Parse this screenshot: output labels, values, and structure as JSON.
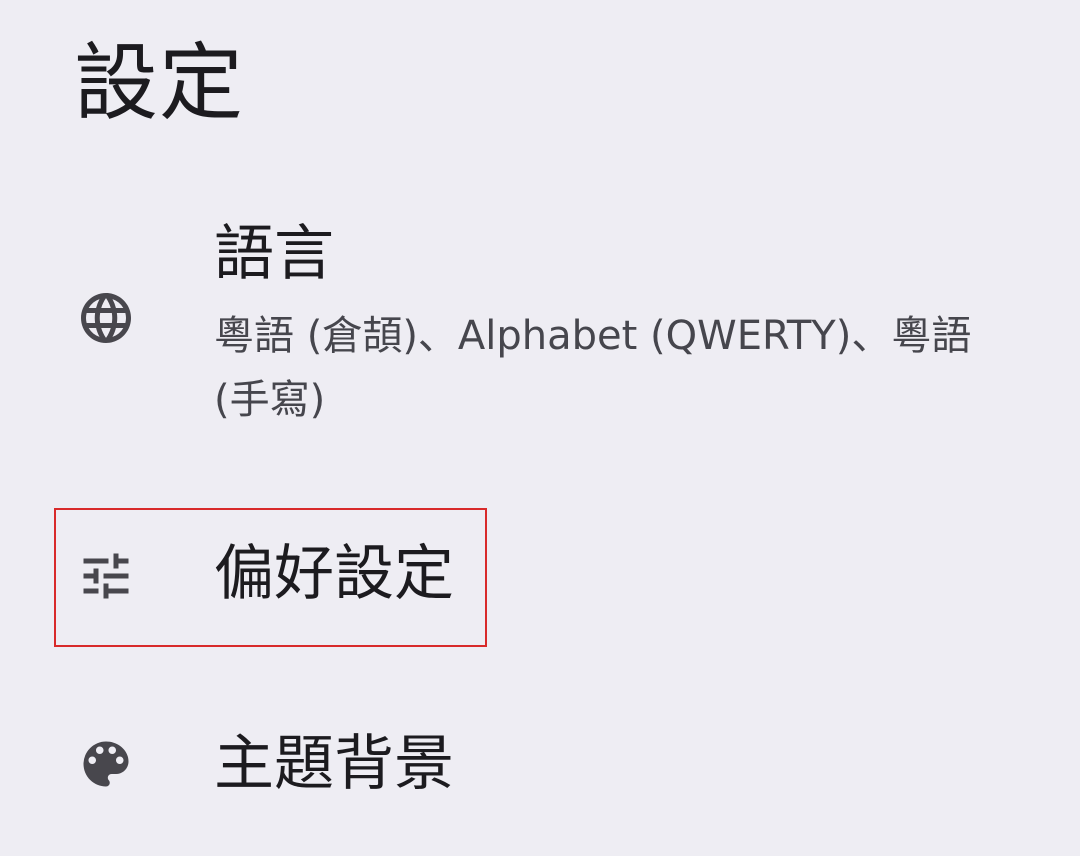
{
  "page": {
    "title": "設定"
  },
  "settings": {
    "items": [
      {
        "title": "語言",
        "summary": "粵語 (倉頡)、Alphabet (QWERTY)、粵語 (手寫)",
        "icon": "globe-icon"
      },
      {
        "title": "偏好設定",
        "icon": "tune-sliders-icon",
        "highlight_color": "#d82a2a"
      },
      {
        "title": "主題背景",
        "icon": "palette-icon"
      }
    ]
  },
  "colors": {
    "background": "#eeedf3",
    "text_primary": "#1c1b1f",
    "text_secondary": "#46464d",
    "icon": "#48474d"
  }
}
